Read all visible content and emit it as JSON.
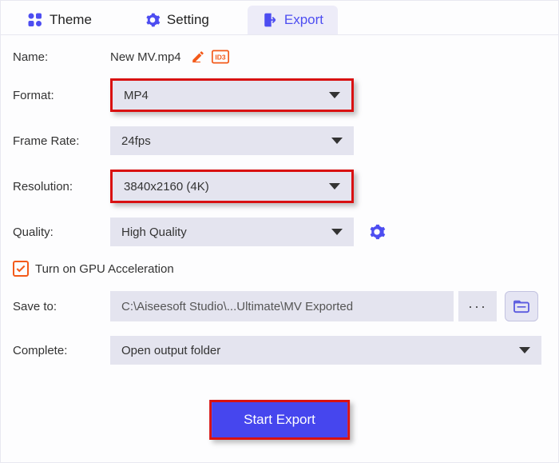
{
  "tabs": {
    "theme": "Theme",
    "setting": "Setting",
    "export": "Export"
  },
  "form": {
    "name_label": "Name:",
    "name_value": "New MV.mp4",
    "format_label": "Format:",
    "format_value": "MP4",
    "frame_rate_label": "Frame Rate:",
    "frame_rate_value": "24fps",
    "resolution_label": "Resolution:",
    "resolution_value": "3840x2160 (4K)",
    "quality_label": "Quality:",
    "quality_value": "High Quality",
    "gpu_label": "Turn on GPU Acceleration",
    "save_to_label": "Save to:",
    "save_to_value": "C:\\Aiseesoft Studio\\...Ultimate\\MV Exported",
    "complete_label": "Complete:",
    "complete_value": "Open output folder"
  },
  "buttons": {
    "start_export": "Start Export"
  }
}
